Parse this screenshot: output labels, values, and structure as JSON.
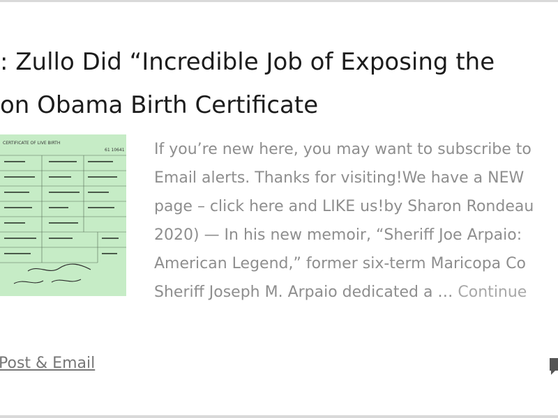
{
  "article": {
    "title_lines": [
      ": Zullo Did “Incredible Job of Exposing the",
      "on Obama Birth Certificate"
    ],
    "excerpt_lines": [
      "If you’re new here, you may want to subscribe to",
      "Email alerts. Thanks for visiting!We have a NEW",
      "page – click here and LIKE us!by Sharon Rondeau",
      "2020) — In his new memoir, “Sheriff Joe Arpaio:",
      "American Legend,” former six-term Maricopa Co",
      "Sheriff Joseph M. Arpaio dedicated a … "
    ],
    "continue_label": "Continue",
    "author_label": "Post & Email",
    "thumbnail": {
      "icon": "birth-certificate-image",
      "header_text": "CERTIFICATE OF LIVE BIRTH",
      "number_text": "61 10641",
      "background_color": "#c6ecc6"
    },
    "comment_icon": "comment-icon"
  }
}
